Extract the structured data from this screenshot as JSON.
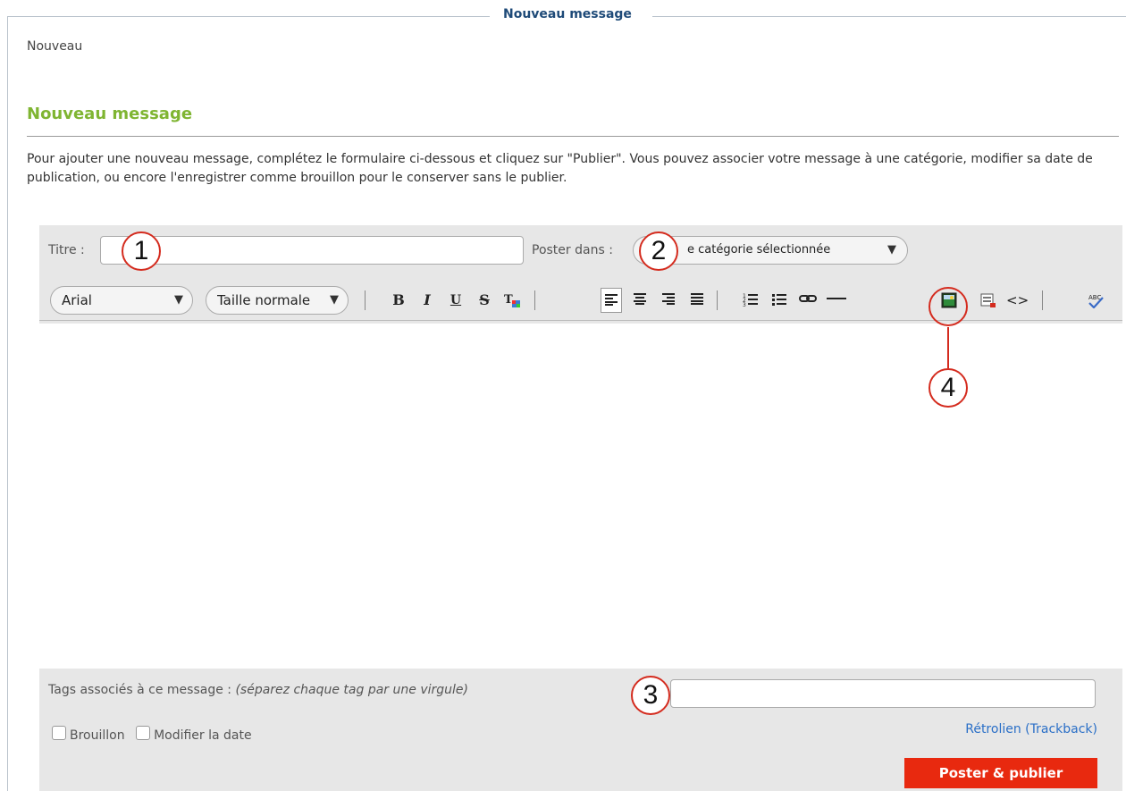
{
  "fieldset": {
    "legend": "Nouveau message"
  },
  "breadcrumb": "Nouveau",
  "page": {
    "title": "Nouveau message",
    "intro": "Pour ajouter une nouveau message, complétez le formulaire ci-dessous et cliquez sur \"Publier\". Vous pouvez associer votre message à une catégorie, modifier sa date de publication, ou encore l'enregistrer comme brouillon pour le conserver sans le publier."
  },
  "form": {
    "title_label": "Titre :",
    "title_value": "",
    "post_in_label": "Poster dans :",
    "category_selected": "e catégorie sélectionnée",
    "font_family": "Arial",
    "font_size": "Taille normale",
    "tags_label": "Tags associés à ce message :",
    "tags_hint": "(séparez chaque tag par une virgule)",
    "tags_value": "",
    "trackback": "Rétrolien (Trackback)",
    "draft_label": "Brouillon",
    "edit_date_label": "Modifier la date",
    "publish_button": "Poster & publier"
  },
  "toolbar": {
    "bold": "B",
    "italic": "I",
    "underline": "U",
    "strike": "S",
    "format": "T",
    "source": "<>"
  },
  "callouts": [
    "1",
    "2",
    "3",
    "4"
  ],
  "colors": {
    "accent_green": "#7fb532",
    "publish_red": "#e8290f",
    "callout_red": "#d42b1e",
    "link_blue": "#2a6fc7"
  }
}
